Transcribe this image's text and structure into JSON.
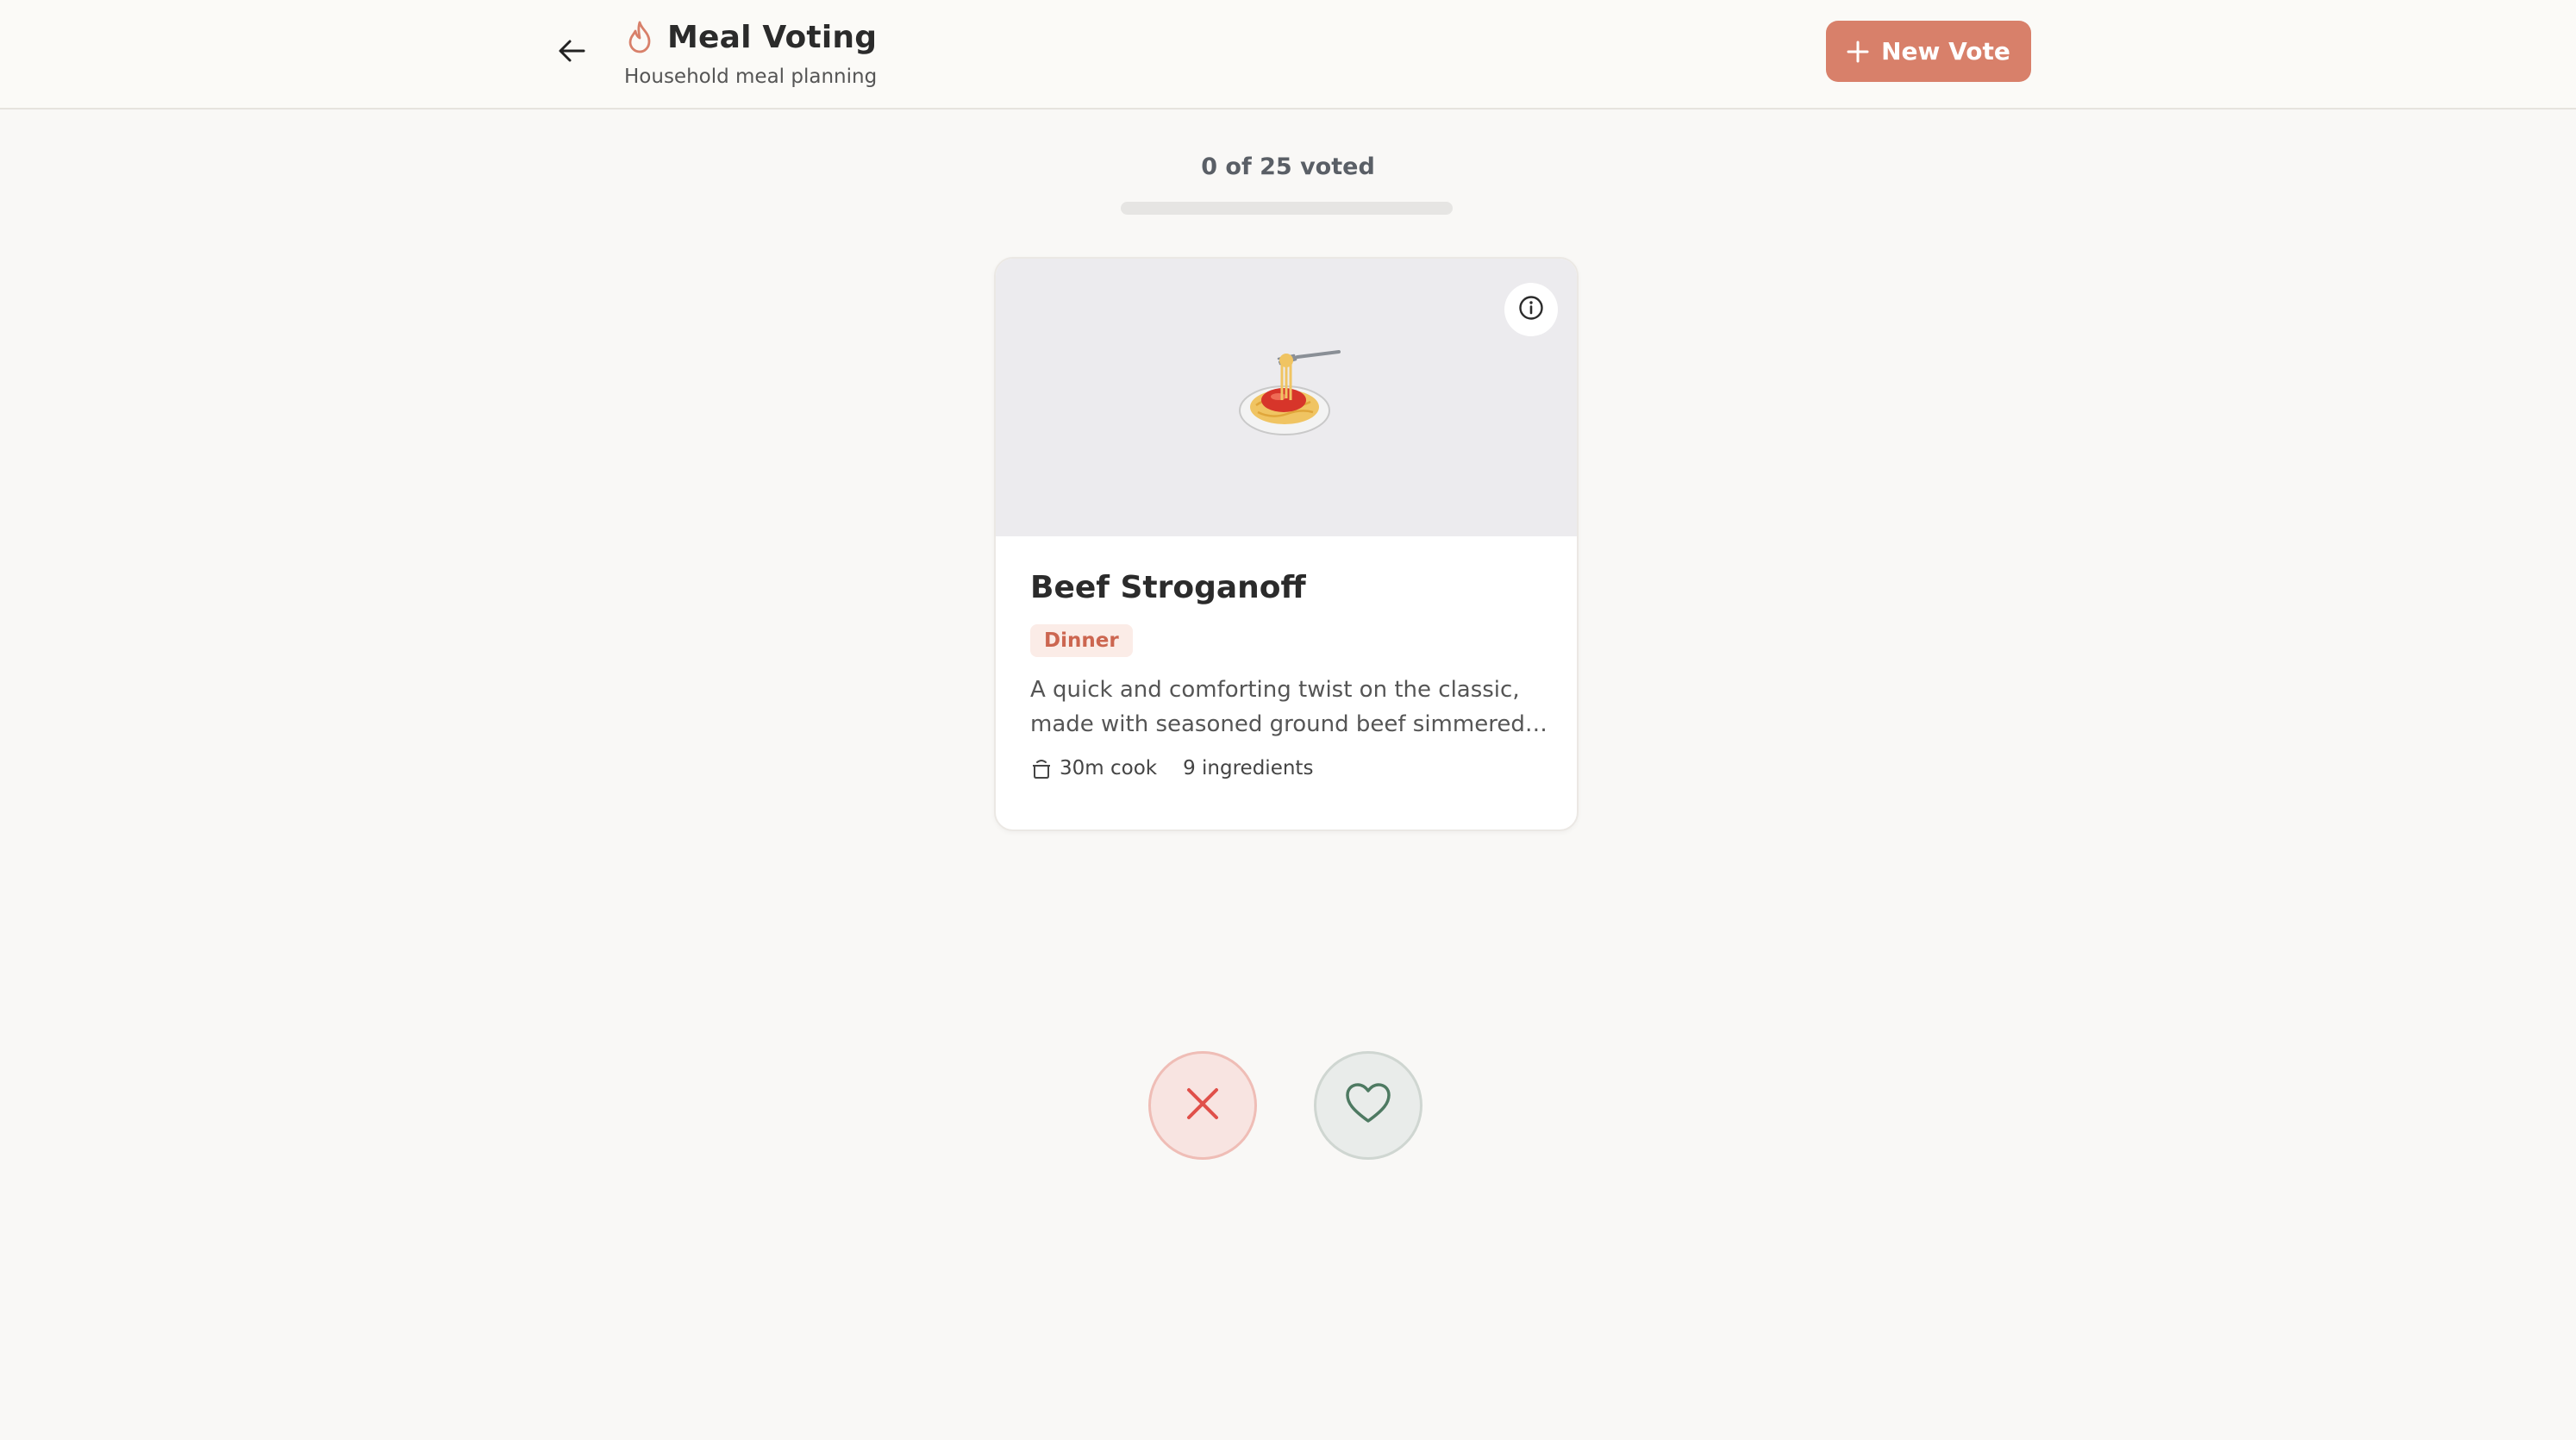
{
  "header": {
    "title": "Meal Voting",
    "subtitle": "Household meal planning",
    "new_vote_label": "New Vote",
    "back_icon": "arrow-left-icon",
    "title_icon": "flame-icon"
  },
  "progress": {
    "label": "0 of 25 voted",
    "voted": 0,
    "total": 25,
    "fraction": 0
  },
  "card": {
    "image_icon": "spaghetti-emoji",
    "name": "Beef Stroganoff",
    "category": "Dinner",
    "description": "A quick and comforting twist on the classic, made with seasoned ground beef simmered…",
    "cook_time": "30m cook",
    "ingredients": "9 ingredients"
  },
  "actions": {
    "reject_icon": "x-icon",
    "like_icon": "heart-icon"
  },
  "colors": {
    "accent": "#d8806a",
    "background": "#f9f8f6",
    "reject_bg": "#f8e4e1",
    "reject_stroke": "#e0504a",
    "like_bg": "#e9ecea",
    "like_stroke": "#4e7a62"
  }
}
